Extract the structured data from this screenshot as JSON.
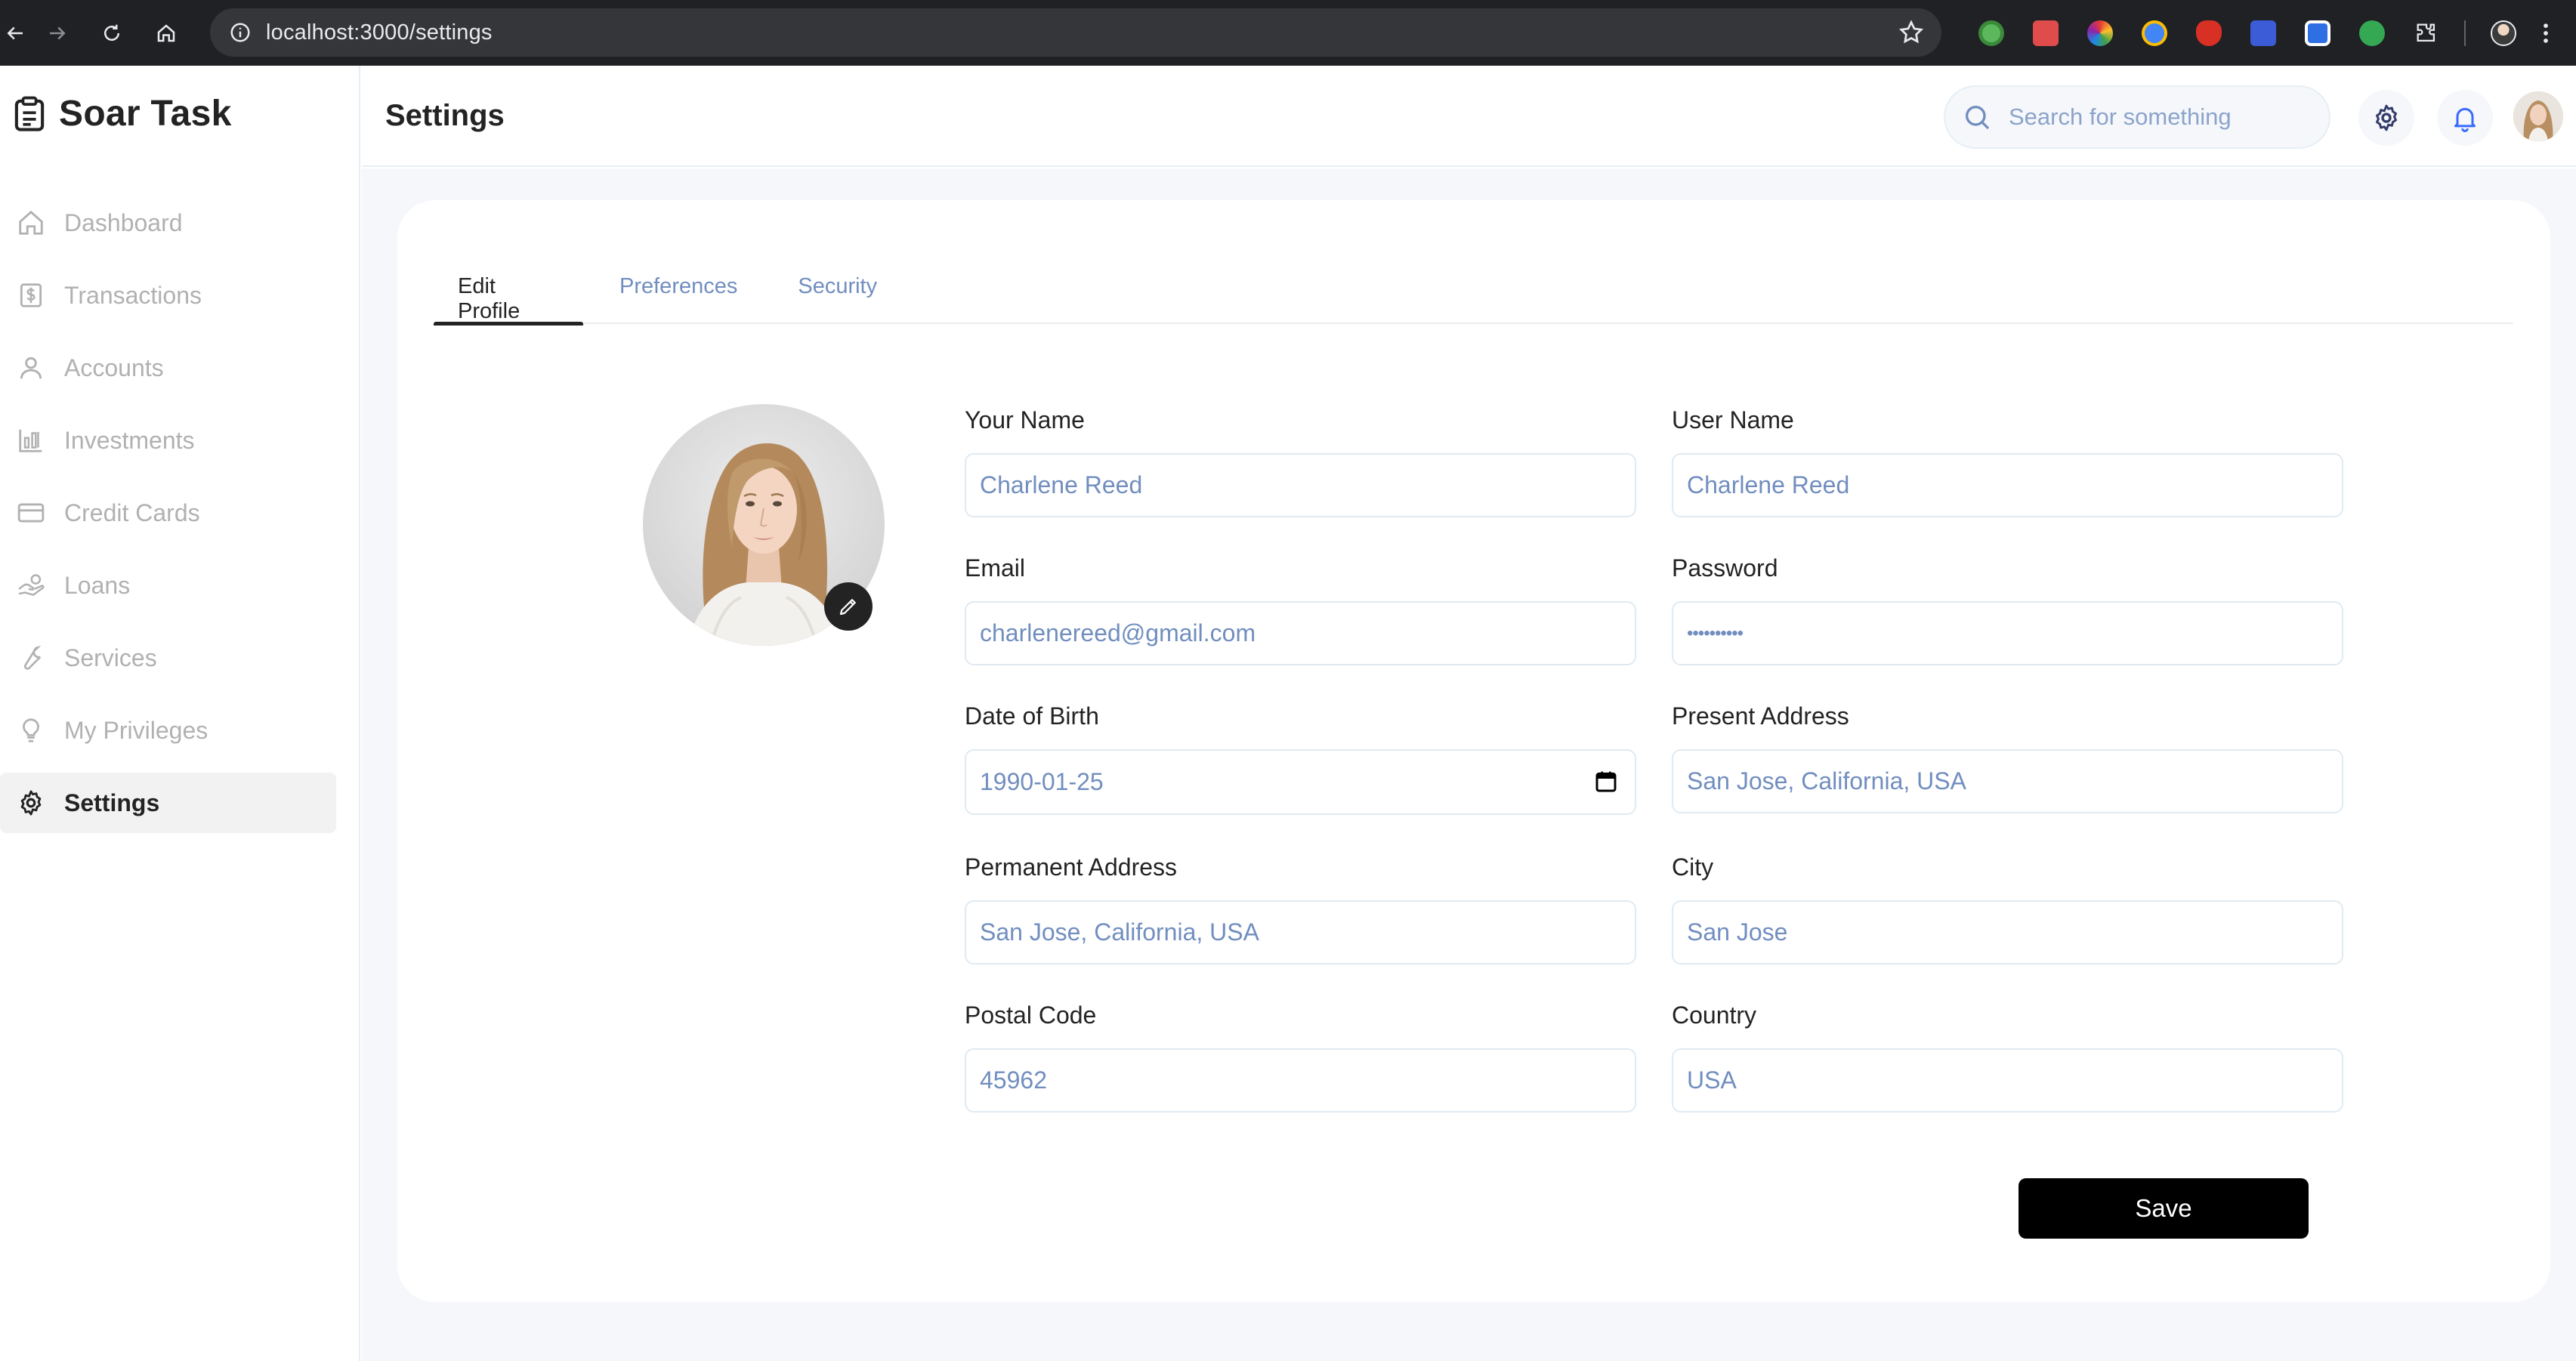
{
  "browser": {
    "url": "localhost:3000/settings"
  },
  "brand": {
    "name": "Soar Task"
  },
  "sidebar": {
    "items": [
      {
        "label": "Dashboard",
        "icon": "home-icon"
      },
      {
        "label": "Transactions",
        "icon": "transfer-icon"
      },
      {
        "label": "Accounts",
        "icon": "user-icon"
      },
      {
        "label": "Investments",
        "icon": "investment-icon"
      },
      {
        "label": "Credit Cards",
        "icon": "credit-card-icon"
      },
      {
        "label": "Loans",
        "icon": "loan-icon"
      },
      {
        "label": "Services",
        "icon": "service-icon"
      },
      {
        "label": "My Privileges",
        "icon": "lightbulb-icon"
      },
      {
        "label": "Settings",
        "icon": "gear-icon",
        "active": true
      }
    ]
  },
  "header": {
    "title": "Settings",
    "search_placeholder": "Search for something"
  },
  "tabs": [
    {
      "label": "Edit Profile",
      "active": true
    },
    {
      "label": "Preferences"
    },
    {
      "label": "Security"
    }
  ],
  "form": {
    "your_name": {
      "label": "Your Name",
      "value": "Charlene Reed"
    },
    "user_name": {
      "label": "User Name",
      "value": "Charlene Reed"
    },
    "email": {
      "label": "Email",
      "value": "charlenereed@gmail.com"
    },
    "password": {
      "label": "Password",
      "value": "••••••••••"
    },
    "dob": {
      "label": "Date of Birth",
      "value": "1990-01-25"
    },
    "present_address": {
      "label": "Present Address",
      "value": "San Jose, California, USA"
    },
    "permanent_address": {
      "label": "Permanent Address",
      "value": "San Jose, California, USA"
    },
    "city": {
      "label": "City",
      "value": "San Jose"
    },
    "postal_code": {
      "label": "Postal Code",
      "value": "45962"
    },
    "country": {
      "label": "Country",
      "value": "USA"
    },
    "save_label": "Save"
  },
  "colors": {
    "accent_blue": "#718ebf",
    "text_dark": "#232323",
    "inactive_nav": "#b1b1b1",
    "background": "#f5f7fa",
    "button": "#000000"
  }
}
